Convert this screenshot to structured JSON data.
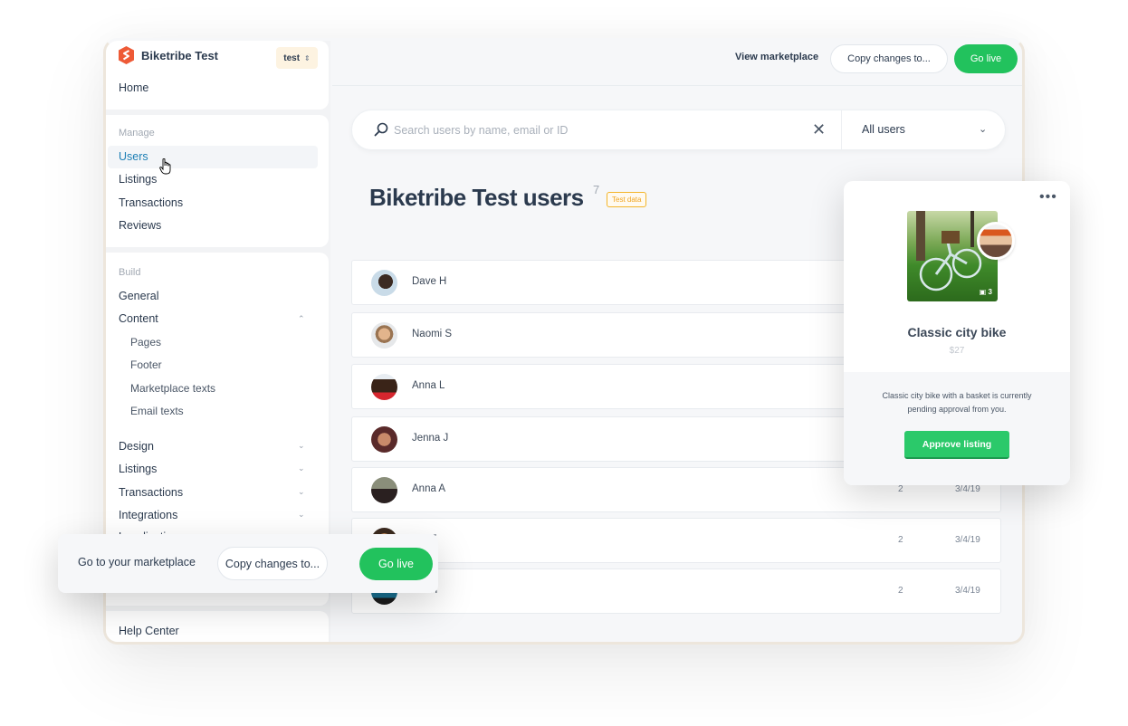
{
  "sidebar": {
    "brand_name": "Biketribe Test",
    "env_badge": "test",
    "home": "Home",
    "manage_section": "Manage",
    "manage_items": [
      "Users",
      "Listings",
      "Transactions",
      "Reviews"
    ],
    "build_section": "Build",
    "general": "General",
    "content": "Content",
    "content_sub": [
      "Pages",
      "Footer",
      "Marketplace texts",
      "Email texts"
    ],
    "collapsible": [
      "Design",
      "Listings",
      "Transactions",
      "Integrations"
    ],
    "partially_hidden": "Localization",
    "help_center": "Help Center"
  },
  "header": {
    "view_marketplace": "View marketplace",
    "copy_changes": "Copy changes to...",
    "go_live": "Go live"
  },
  "search": {
    "placeholder": "Search users by name, email or ID",
    "filter_selected": "All users"
  },
  "page": {
    "title": "Biketribe Test users",
    "count": "7",
    "test_tag": "Test data"
  },
  "users": [
    {
      "name": "Dave H",
      "count": "",
      "date": ""
    },
    {
      "name": "Naomi S",
      "count": "",
      "date": ""
    },
    {
      "name": "Anna L",
      "count": "",
      "date": ""
    },
    {
      "name": "Jenna J",
      "count": "",
      "date": ""
    },
    {
      "name": "Anna A",
      "count": "2",
      "date": "3/4/19"
    },
    {
      "name": "E",
      "count": "2",
      "date": "3/4/19"
    },
    {
      "name": "H",
      "count": "2",
      "date": "3/4/19"
    }
  ],
  "listing_card": {
    "title": "Classic city bike",
    "price": "$27",
    "photo_count": "3",
    "description": "Classic city bike with a basket is currently pending approval from you.",
    "approve_label": "Approve listing"
  },
  "float_bar": {
    "label": "Go to your marketplace",
    "copy_changes": "Copy changes to...",
    "go_live": "Go live"
  },
  "colors": {
    "accent_green": "#22c25d",
    "active_link": "#1d7fb5",
    "brand_orange": "#ee5a36",
    "test_tag": "#f0a521"
  }
}
